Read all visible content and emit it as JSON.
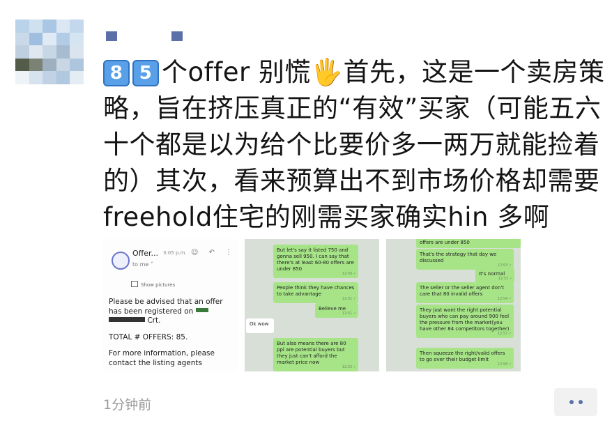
{
  "post": {
    "text_after_keycaps": "个offer 别慌🖐首先，这是一个卖房策略，旨在挤压真正的“有效”买家（可能五六十个都是以为给个比要价多一两万就能捡着的）其次，看来预算出不到市场价格却需要freehold住宅的刚需买家确实hin 多啊",
    "keycap_1": "8",
    "keycap_2": "5",
    "time": "1分钟前"
  },
  "avatar": {
    "colors": [
      "#b9d3ea",
      "#cfe0ef",
      "#a9c6e4",
      "#dbe7f2",
      "#c3d8ec",
      "#cad9ea",
      "#a0bfe0",
      "#e0eaf4",
      "#b3cce6",
      "#d5e4f1",
      "#bfcfdf",
      "#dfe8f1",
      "#c8d7e6",
      "#a8bcd0",
      "#d9e4ef",
      "#555b49",
      "#7a8273",
      "#9eb0c0",
      "#c9d6e3",
      "#aec6dd",
      "#eef3f8",
      "#d6e2ee",
      "#c0d2e4",
      "#b0c8e0",
      "#e4ecf4"
    ]
  },
  "thumbnails": {
    "email": {
      "sender": "Offer...",
      "time": "3:05 p.m.",
      "to": "to me ˅",
      "icons": "☺ ↶ ⋮",
      "show_pictures": "Show pictures",
      "para1_a": "Please be advised that an offer",
      "para1_b": "has been registered on",
      "para1_c": "Crt.",
      "total": "TOTAL # OFFERS: 85.",
      "para3_a": "For more information, please",
      "para3_b": "contact the listing agents"
    },
    "chat1": {
      "messages": [
        {
          "text": "But let's say it listed 750 and gonna sell 950. I can say that there's at least 60-80 offers are under 850",
          "time": "12:50 ✓"
        },
        {
          "text": "People think they have chances to take advantage",
          "time": "12:51 ✓"
        },
        {
          "text": "Believe me",
          "time": "12:51 ✓"
        },
        {
          "text": "Ok wow",
          "time": ""
        },
        {
          "text": "But also means there are 80 ppl are potential buyers but they just can't afford the market price now",
          "time": "12:52 ✓"
        }
      ]
    },
    "chat2": {
      "messages": [
        {
          "text": "offers are under 850",
          "time": ""
        },
        {
          "text": "That's the strategy that day we discussed",
          "time": "12:53 ✓"
        },
        {
          "text": "It's normal",
          "time": "12:53 ✓"
        },
        {
          "text": "The seller or the seller agent don't care that 80 invalid offers",
          "time": "12:54 ✓"
        },
        {
          "text": "They just want the right potential buyers who can pay around 900 feel the pressure from the market(you have other 84 competitors together)",
          "time": "12:57 ✓"
        },
        {
          "text": "Then squeeze the right/valid offers to go over their budget limit",
          "time": "12:58 ✓"
        }
      ]
    }
  }
}
